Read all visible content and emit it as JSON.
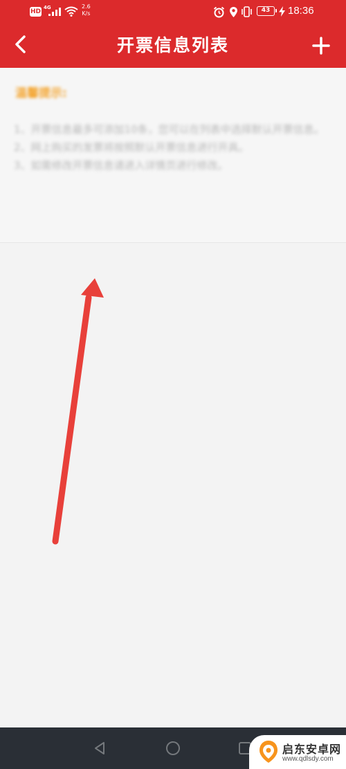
{
  "status_bar": {
    "hd": "HD",
    "network_type": "4G",
    "speed_value": "2.6",
    "speed_unit": "K/s",
    "battery": "43",
    "time": "18:36"
  },
  "app_bar": {
    "title": "开票信息列表"
  },
  "tips": {
    "title": "温馨提示:",
    "items": [
      "1、开票信息最多可添加10条，您可以在列表中选择默认开票信息。",
      "2、网上购买的发票将按照默认开票信息进行开具。",
      "3、如需修改开票信息请进入详情页进行修改。"
    ]
  },
  "watermark": {
    "name": "启东安卓网",
    "url": "www.qdlsdy.com"
  },
  "colors": {
    "brand_red": "#dc2a2c",
    "tip_title": "#f4a530",
    "background": "#f3f3f3",
    "arrow": "#e8403a",
    "nav_bar": "#2a2f36"
  }
}
